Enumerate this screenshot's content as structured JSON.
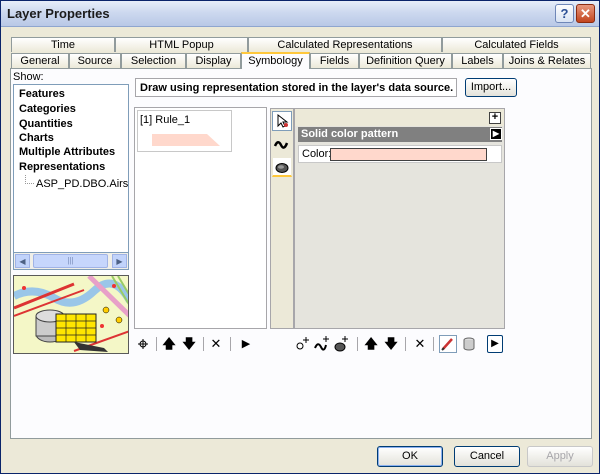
{
  "window": {
    "title": "Layer Properties"
  },
  "tabs_row1": [
    "Time",
    "HTML Popup",
    "Calculated Representations",
    "Calculated Fields"
  ],
  "tabs_row2": [
    "General",
    "Source",
    "Selection",
    "Display",
    "Symbology",
    "Fields",
    "Definition Query",
    "Labels",
    "Joins & Relates"
  ],
  "active_tab": "Symbology",
  "show": {
    "label": "Show:",
    "items": [
      "Features",
      "Categories",
      "Quantities",
      "Charts",
      "Multiple Attributes",
      "Representations"
    ],
    "subitem": "ASP_PD.DBO.Airspa"
  },
  "description": "Draw using representation stored in the layer's data source.",
  "import_label": "Import...",
  "rules": [
    {
      "label": "[1] Rule_1"
    }
  ],
  "props": {
    "header": "Solid color pattern",
    "color_label": "Color:"
  },
  "colors": {
    "fill": "#ffd8cc",
    "title_bar": "#cdd9ef",
    "tab_highlight": "#ffc83c"
  },
  "buttons": {
    "ok": "OK",
    "cancel": "Cancel",
    "apply": "Apply"
  }
}
